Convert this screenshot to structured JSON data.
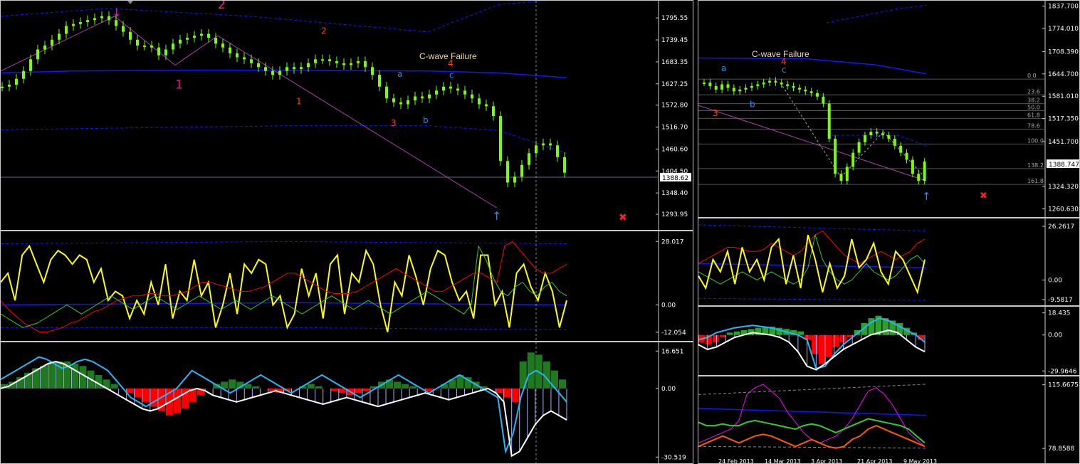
{
  "colors": {
    "background": "#000000",
    "candle": "#7cfc00",
    "wave_primary": "#ff1493",
    "wave_orange": "#ff4500",
    "wave_blue": "#1e90ff",
    "band_blue": "#1414ff",
    "yellow": "#ffff00",
    "red": "#ff0000",
    "green": "#32cd32",
    "cyan": "#29b6f6",
    "magenta": "#ff00ff",
    "orange": "#ff5a00",
    "lavender": "#b0b0ff"
  },
  "chart_data": [
    {
      "type": "line",
      "id": "left-price",
      "annotation": "C-wave Failure",
      "current_price": "1388.62",
      "yticks": [
        "1795.55",
        "1739.45",
        "1683.35",
        "1627.25",
        "1572.80",
        "1516.70",
        "1460.60",
        "1404.50",
        "1348.40",
        "1293.95"
      ],
      "ylim": [
        1265,
        1825
      ],
      "x": [
        0,
        10,
        20,
        30,
        40,
        50,
        60,
        70,
        80,
        90,
        100,
        110,
        120,
        130,
        140,
        150,
        160,
        170,
        180,
        190,
        200,
        210,
        220,
        230,
        240,
        250,
        260,
        270,
        280,
        290,
        300,
        310,
        320,
        330,
        340,
        350,
        360,
        370,
        380,
        390,
        400,
        410,
        420,
        430,
        440,
        450,
        460,
        470,
        480,
        490,
        500,
        510,
        520,
        530,
        540,
        550,
        560,
        570,
        580,
        590,
        600,
        610,
        620,
        630,
        640,
        650,
        660,
        670,
        680,
        690,
        700,
        710,
        720,
        730,
        740,
        750,
        760,
        770,
        780,
        790
      ],
      "close": [
        1620,
        1625,
        1640,
        1660,
        1690,
        1715,
        1725,
        1740,
        1755,
        1775,
        1780,
        1785,
        1790,
        1795,
        1800,
        1790,
        1775,
        1760,
        1740,
        1725,
        1725,
        1720,
        1700,
        1715,
        1730,
        1740,
        1745,
        1750,
        1755,
        1745,
        1730,
        1720,
        1705,
        1695,
        1690,
        1680,
        1670,
        1660,
        1650,
        1660,
        1670,
        1665,
        1670,
        1680,
        1690,
        1690,
        1685,
        1680,
        1675,
        1680,
        1685,
        1670,
        1650,
        1620,
        1590,
        1580,
        1575,
        1585,
        1595,
        1590,
        1600,
        1610,
        1620,
        1615,
        1610,
        1600,
        1590,
        1575,
        1570,
        1545,
        1430,
        1375,
        1390,
        1420,
        1450,
        1470,
        1475,
        1470,
        1440,
        1400
      ],
      "wave_labels": [
        {
          "text": "1",
          "color": "wave_primary",
          "x": 245,
          "price": 1615
        },
        {
          "text": "2",
          "color": "wave_primary",
          "x": 305,
          "price": 1820
        },
        {
          "text": "2",
          "color": "wave_orange",
          "x": 450,
          "price": 1755
        },
        {
          "text": "1",
          "color": "wave_orange",
          "x": 415,
          "price": 1575
        },
        {
          "text": "3",
          "color": "wave_orange",
          "x": 548,
          "price": 1520
        },
        {
          "text": "4",
          "color": "wave_orange",
          "x": 628,
          "price": 1672
        },
        {
          "text": "a",
          "color": "wave_blue",
          "x": 557,
          "price": 1645
        },
        {
          "text": "b",
          "color": "wave_blue",
          "x": 593,
          "price": 1527
        },
        {
          "text": "c",
          "color": "wave_blue",
          "x": 630,
          "price": 1642
        }
      ],
      "upper_band": [
        1835,
        1838,
        1840
      ],
      "mid_band": [
        1670,
        1665,
        1660,
        1660,
        1660,
        1660,
        1658,
        1650,
        1640,
        1640
      ],
      "lower_band": [
        1510,
        1512,
        1515,
        1518,
        1520,
        1520,
        1520,
        1518,
        1515,
        1510,
        1500,
        1480
      ]
    },
    {
      "type": "line",
      "id": "left-osc1",
      "yticks": [
        "28.017",
        "0.00",
        "-12.054"
      ],
      "ylim": [
        -14,
        30
      ],
      "series": [
        {
          "color": "yellow",
          "values": [
            10,
            14,
            2,
            22,
            26,
            18,
            10,
            20,
            24,
            22,
            18,
            22,
            20,
            10,
            16,
            2,
            6,
            4,
            -6,
            2,
            -4,
            10,
            0,
            18,
            -6,
            6,
            2,
            20,
            4,
            10,
            -10,
            0,
            14,
            -4,
            18,
            14,
            20,
            18,
            0,
            4,
            -10,
            -4,
            16,
            4,
            14,
            -6,
            18,
            22,
            -4,
            14,
            10,
            24,
            18,
            0,
            -12,
            10,
            4,
            22,
            12,
            0,
            16,
            24,
            22,
            10,
            2,
            6,
            -6,
            22,
            22,
            0,
            6,
            -10,
            14,
            18,
            8,
            2,
            14,
            6,
            -10,
            2
          ]
        },
        {
          "color": "red",
          "values": [
            2,
            -2,
            -5,
            -8,
            -10,
            -12,
            -12,
            -11,
            -10,
            -8,
            -7,
            -5,
            -3,
            -2,
            0,
            2,
            3,
            4,
            4,
            5,
            5,
            4,
            4,
            5,
            6,
            8,
            10,
            10,
            9,
            8,
            7,
            6,
            6,
            7,
            8,
            10,
            12,
            14,
            14,
            12,
            10,
            8,
            6,
            5,
            5,
            5,
            6,
            8,
            10,
            12,
            14,
            16,
            14,
            12,
            10,
            8,
            6,
            6,
            8,
            10,
            12,
            14,
            14,
            12,
            10,
            26,
            28,
            24,
            20,
            16,
            14,
            14,
            16,
            18
          ]
        },
        {
          "color": "green",
          "values": [
            -4,
            -6,
            -8,
            -10,
            -9,
            -8,
            -6,
            -4,
            -2,
            0,
            -2,
            -4,
            -2,
            0,
            2,
            4,
            2,
            0,
            -2,
            0,
            2,
            4,
            2,
            0,
            -2,
            0,
            2,
            4,
            2,
            0,
            -2,
            0,
            2,
            0,
            -2,
            0,
            2,
            4,
            2,
            0,
            -2,
            -4,
            -2,
            0,
            2,
            4,
            2,
            0,
            -2,
            0,
            2,
            0,
            -2,
            -4,
            -2,
            0,
            2,
            4,
            6,
            4,
            2,
            0,
            -2,
            -4,
            0,
            26,
            20,
            12,
            6,
            4,
            8,
            10,
            6,
            4,
            8,
            10,
            6,
            4
          ]
        }
      ]
    },
    {
      "type": "bar",
      "id": "left-osc2",
      "yticks": [
        "16.651",
        "0.00",
        "-30.519"
      ],
      "ylim": [
        -32,
        18
      ],
      "histogram": [
        2,
        3,
        5,
        7,
        9,
        10,
        11,
        12,
        12,
        11,
        10,
        8,
        6,
        4,
        2,
        0,
        -2,
        -4,
        -6,
        -8,
        -10,
        -12,
        -11,
        -9,
        -6,
        -3,
        0,
        2,
        3,
        4,
        3,
        2,
        1,
        0,
        -1,
        -2,
        -1,
        0,
        1,
        2,
        1,
        0,
        -1,
        -2,
        -3,
        -2,
        -1,
        1,
        3,
        4,
        3,
        2,
        1,
        0,
        -1,
        0,
        2,
        4,
        6,
        5,
        3,
        1,
        0,
        -2,
        -4,
        -6,
        12,
        16,
        15,
        12,
        8,
        4
      ],
      "cyan": [
        4,
        6,
        8,
        10,
        12,
        14,
        13,
        11,
        9,
        10,
        12,
        13,
        12,
        10,
        8,
        4,
        0,
        -4,
        -6,
        -8,
        -6,
        -4,
        -2,
        0,
        4,
        8,
        6,
        4,
        2,
        0,
        -2,
        0,
        2,
        4,
        6,
        4,
        2,
        0,
        -2,
        0,
        2,
        4,
        6,
        4,
        2,
        0,
        -2,
        -4,
        -2,
        0,
        2,
        4,
        6,
        4,
        2,
        0,
        -2,
        0,
        2,
        4,
        6,
        4,
        2,
        0,
        -2,
        -4,
        -28,
        -20,
        -4,
        6,
        8,
        6,
        2,
        -2,
        -6
      ],
      "white": [
        0,
        1,
        3,
        5,
        7,
        9,
        11,
        12,
        11,
        9,
        7,
        5,
        3,
        1,
        -1,
        -3,
        -5,
        -7,
        -9,
        -10,
        -9,
        -7,
        -5,
        -3,
        -1,
        0,
        -1,
        -3,
        -4,
        -5,
        -6,
        -5,
        -4,
        -3,
        -2,
        -1,
        -2,
        -3,
        -4,
        -5,
        -6,
        -7,
        -6,
        -5,
        -4,
        -5,
        -6,
        -7,
        -8,
        -7,
        -6,
        -5,
        -4,
        -3,
        -2,
        -3,
        -4,
        -5,
        -4,
        -3,
        -2,
        -1,
        0,
        -2,
        -6,
        -30,
        -28,
        -22,
        -16,
        -12,
        -10,
        -12,
        -14
      ]
    },
    {
      "type": "line",
      "id": "right-price",
      "annotation": "C-wave Failure",
      "current_price": "1388.747",
      "yticks": [
        "1837.700",
        "1774.010",
        "1708.390",
        "1644.700",
        "1581.010",
        "1517.350",
        "1451.700",
        "1388.747",
        "1324.320",
        "1260.630"
      ],
      "ylim": [
        1245,
        1845
      ],
      "fib_levels": [
        "0.0",
        "23.6",
        "38.2",
        "50.0",
        "61.8",
        "78.6",
        "100.0",
        "138.2",
        "161.8"
      ],
      "close": [
        1620,
        1610,
        1600,
        1615,
        1605,
        1595,
        1600,
        1605,
        1610,
        1615,
        1620,
        1625,
        1620,
        1615,
        1610,
        1605,
        1600,
        1595,
        1590,
        1580,
        1560,
        1460,
        1360,
        1340,
        1380,
        1420,
        1450,
        1470,
        1480,
        1475,
        1470,
        1460,
        1440,
        1420,
        1400,
        1360,
        1340,
        1395
      ],
      "wave_labels": [
        {
          "text": "3",
          "color": "wave_orange",
          "x": 1000,
          "price": 1525
        },
        {
          "text": "4",
          "color": "wave_orange",
          "x": 1096,
          "price": 1672
        },
        {
          "text": "a",
          "color": "wave_blue",
          "x": 1012,
          "price": 1652
        },
        {
          "text": "b",
          "color": "wave_blue",
          "x": 1052,
          "price": 1550
        },
        {
          "text": "c",
          "color": "wave_blue",
          "x": 1097,
          "price": 1648
        }
      ]
    },
    {
      "type": "line",
      "id": "right-osc1",
      "yticks": [
        "26.2617",
        "0.00",
        "-9.5817"
      ],
      "ylim": [
        -11,
        28
      ]
    },
    {
      "type": "bar",
      "id": "right-osc2",
      "yticks": [
        "18.435",
        "0.00",
        "-29.9646"
      ],
      "ylim": [
        -31,
        20
      ]
    },
    {
      "type": "line",
      "id": "right-osc3",
      "yticks": [
        "115.6675",
        "78.8588"
      ],
      "ylim": [
        76,
        118
      ],
      "xticks": [
        "24 Feb 2013",
        "14 Mar 2013",
        "3 Apr 2013",
        "21 Apr 2013",
        "9 May 2013"
      ]
    }
  ]
}
